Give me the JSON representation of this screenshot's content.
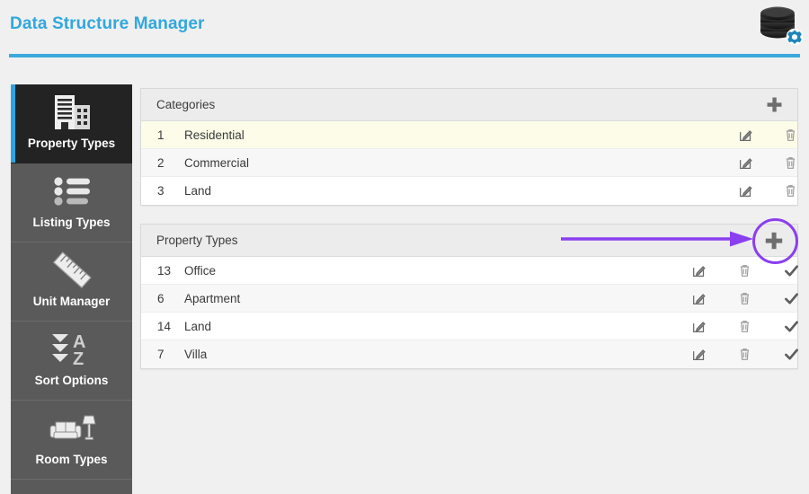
{
  "header": {
    "title": "Data Structure Manager",
    "icon": "database-gear-icon",
    "accent_color": "#3aa9dc",
    "title_color": "#31a8dd"
  },
  "sidebar": {
    "items": [
      {
        "label": "Property Types",
        "icon": "building-icon",
        "active": true
      },
      {
        "label": "Listing Types",
        "icon": "bullet-list-icon",
        "active": false
      },
      {
        "label": "Unit Manager",
        "icon": "ruler-icon",
        "active": false
      },
      {
        "label": "Sort Options",
        "icon": "sort-az-icon",
        "active": false
      },
      {
        "label": "Room Types",
        "icon": "sofa-lamp-icon",
        "active": false
      }
    ]
  },
  "panels": [
    {
      "id": "categories",
      "title": "Categories",
      "add_icon": "plus-icon",
      "actions": [
        "edit-icon",
        "delete-icon",
        "move-icon"
      ],
      "rows": [
        {
          "id": "1",
          "name": "Residential",
          "highlight": true
        },
        {
          "id": "2",
          "name": "Commercial",
          "highlight": false
        },
        {
          "id": "3",
          "name": "Land",
          "highlight": false
        }
      ]
    },
    {
      "id": "propertytypes",
      "title": "Property Types",
      "add_icon": "plus-icon",
      "actions": [
        "edit-icon",
        "delete-icon",
        "check-icon",
        "move-icon"
      ],
      "rows": [
        {
          "id": "13",
          "name": "Office",
          "highlight": false
        },
        {
          "id": "6",
          "name": "Apartment",
          "highlight": false
        },
        {
          "id": "14",
          "name": "Land",
          "highlight": false
        },
        {
          "id": "7",
          "name": "Villa",
          "highlight": false
        }
      ]
    }
  ],
  "annotation": {
    "color": "#8a3ff0",
    "arrow": "arrow-right",
    "target": "add-property-type-button"
  }
}
